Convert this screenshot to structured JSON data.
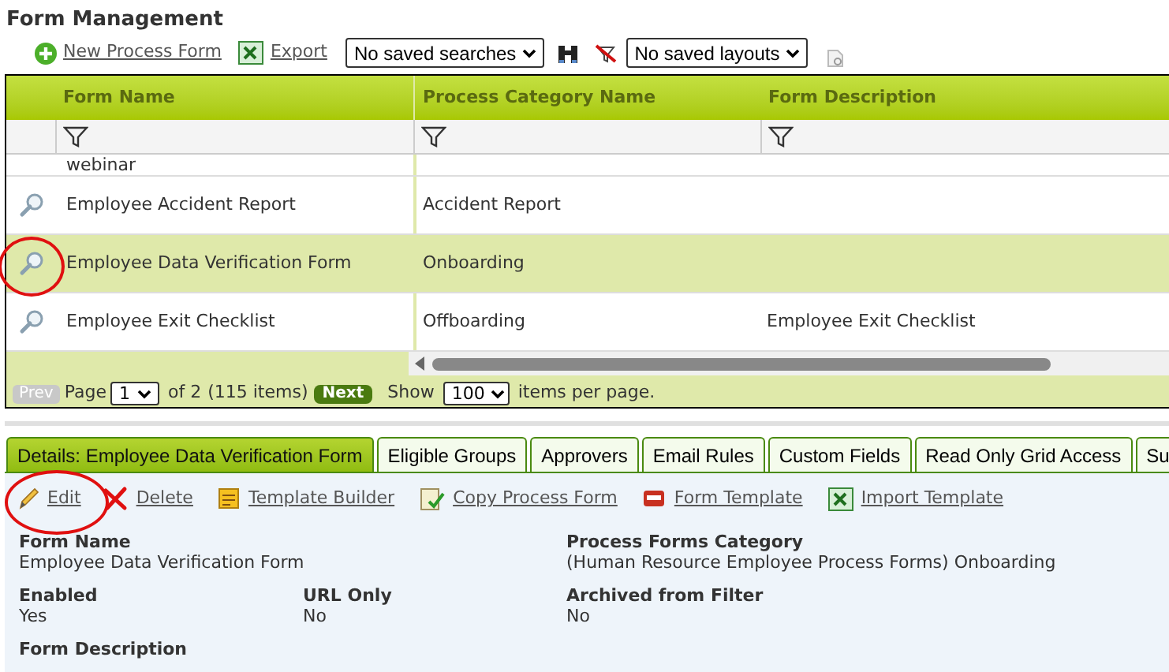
{
  "title": "Form Management",
  "toolbar": {
    "new_link": "New Process Form",
    "export_link": "Export",
    "saved_searches": "No saved searches",
    "saved_layouts": "No saved layouts"
  },
  "grid": {
    "columns": [
      "Form Name",
      "Process Category Name",
      "Form Description"
    ],
    "partial_row": {
      "name": "webinar"
    },
    "rows": [
      {
        "name": "Employee Accident Report",
        "category": "Accident Report",
        "selected": false
      },
      {
        "name": "Employee Data Verification Form",
        "category": "Onboarding",
        "selected": true
      },
      {
        "name": "Employee Exit Checklist",
        "category": "Offboarding",
        "description": "Employee Exit Checklist",
        "selected": false
      }
    ],
    "pager": {
      "prev": "Prev",
      "page_label": "Page",
      "page": "1",
      "of": "of 2",
      "items": "(115 items)",
      "next": "Next",
      "show": "Show",
      "per_page": "100",
      "per_page_label": "items per page."
    }
  },
  "tabs": [
    {
      "label": "Details: Employee Data Verification Form",
      "selected": true
    },
    {
      "label": "Eligible Groups",
      "selected": false
    },
    {
      "label": "Approvers",
      "selected": false
    },
    {
      "label": "Email Rules",
      "selected": false
    },
    {
      "label": "Custom Fields",
      "selected": false
    },
    {
      "label": "Read Only Grid Access",
      "selected": false
    },
    {
      "label": "Su",
      "selected": false
    }
  ],
  "actions": [
    {
      "kind": "edit",
      "label": "Edit"
    },
    {
      "kind": "delete",
      "label": "Delete"
    },
    {
      "kind": "builder",
      "label": "Template Builder"
    },
    {
      "kind": "copy",
      "label": "Copy Process Form"
    },
    {
      "kind": "pdf",
      "label": "Form Template"
    },
    {
      "kind": "excel",
      "label": "Import Template"
    }
  ],
  "details": [
    {
      "label": "Form Name",
      "value": "Employee Data Verification Form"
    },
    {
      "label": "Process Forms Category",
      "value": "(Human Resource Employee Process Forms) Onboarding"
    },
    {
      "label": "Enabled",
      "value": "Yes"
    },
    {
      "label": "URL Only",
      "value": "No"
    },
    {
      "label": "Archived from Filter",
      "value": "No"
    },
    {
      "label": "Form Description"
    }
  ]
}
